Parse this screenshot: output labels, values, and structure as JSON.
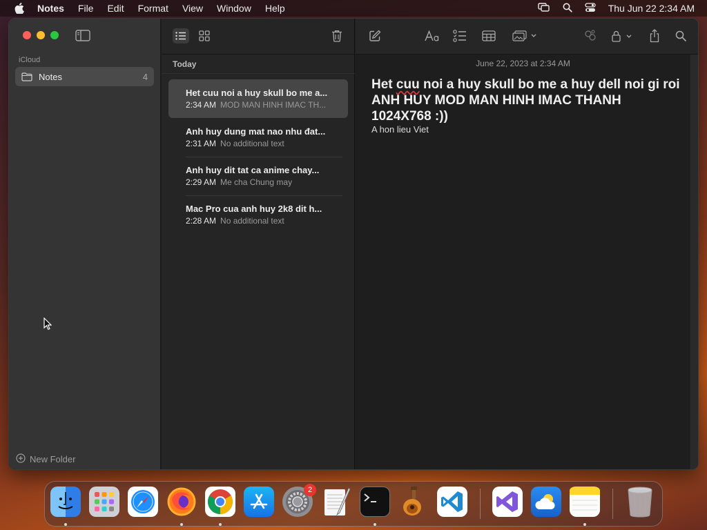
{
  "menubar": {
    "app": "Notes",
    "items": [
      "File",
      "Edit",
      "Format",
      "View",
      "Window",
      "Help"
    ],
    "clock": "Thu Jun 22  2:34 AM"
  },
  "sidebar": {
    "section": "iCloud",
    "folder": {
      "name": "Notes",
      "count": "4"
    },
    "new_folder": "New Folder"
  },
  "notelist": {
    "group": "Today",
    "notes": [
      {
        "title": "Het cuu noi a huy skull bo me a...",
        "time": "2:34 AM",
        "preview": "MOD MAN HINH IMAC TH...",
        "selected": true
      },
      {
        "title": "Anh huy dung mat nao nhu đat...",
        "time": "2:31 AM",
        "preview": "No additional text"
      },
      {
        "title": "Anh huy dit tat ca anime chay...",
        "time": "2:29 AM",
        "preview": "Me cha Chung may"
      },
      {
        "title": "Mac Pro cua anh huy 2k8 dit h...",
        "time": "2:28 AM",
        "preview": "No additional text"
      }
    ]
  },
  "editor": {
    "date": "June 22, 2023 at 2:34 AM",
    "title_pre": "Het ",
    "title_squig": "cuu",
    "title_post": " noi a huy skull bo me a huy dell noi gi roi      ANH HUY MOD MAN HINH IMAC THANH 1024X768 :))",
    "body": "A hon lieu Viet"
  },
  "dock": {
    "badge_settings": "2"
  },
  "colors": {
    "accent_red": "#fe5f57",
    "accent_yellow": "#febc2e",
    "accent_green": "#28c840",
    "selection": "#464646"
  }
}
